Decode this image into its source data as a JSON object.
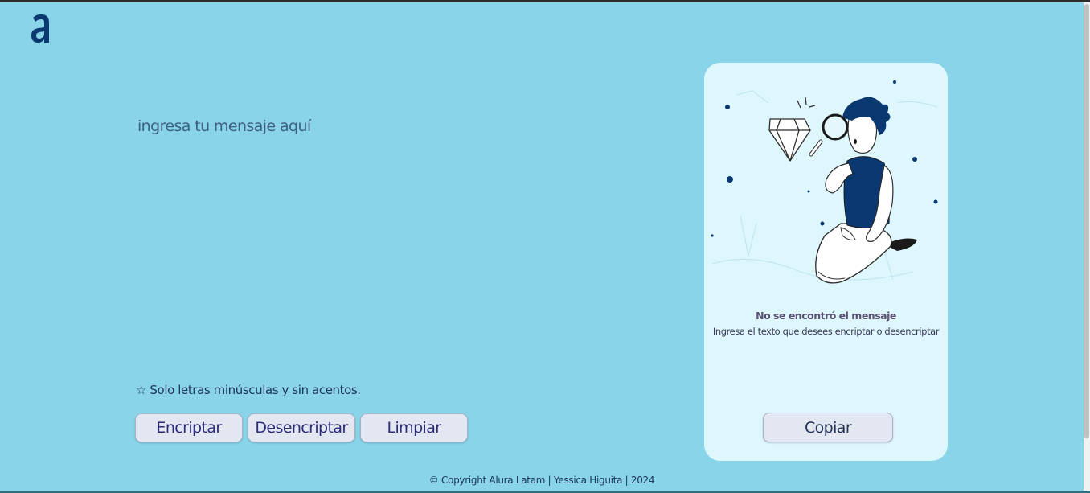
{
  "header": {
    "logo_icon": "alura-logo-icon",
    "logo_color": "#0a3871"
  },
  "editor": {
    "placeholder": "ingresa tu mensaje aquí",
    "value": ""
  },
  "hint": {
    "text": "☆ Solo letras minúsculas y sin acentos."
  },
  "actions": {
    "encrypt_label": "Encriptar",
    "decrypt_label": "Desencriptar",
    "clear_label": "Limpiar"
  },
  "output": {
    "illustration": "person-with-magnifier-diamond-illustration",
    "title": "No se encontró el mensaje",
    "subtitle": "Ingresa el texto que desees encriptar o desencriptar",
    "copy_label": "Copiar"
  },
  "footer": {
    "text": "© Copyright Alura Latam | Yessica Higuita | 2024"
  },
  "colors": {
    "background": "#89d4e9",
    "card": "#def7fd",
    "button": "#e3e7f2",
    "accent": "#0a3871"
  }
}
